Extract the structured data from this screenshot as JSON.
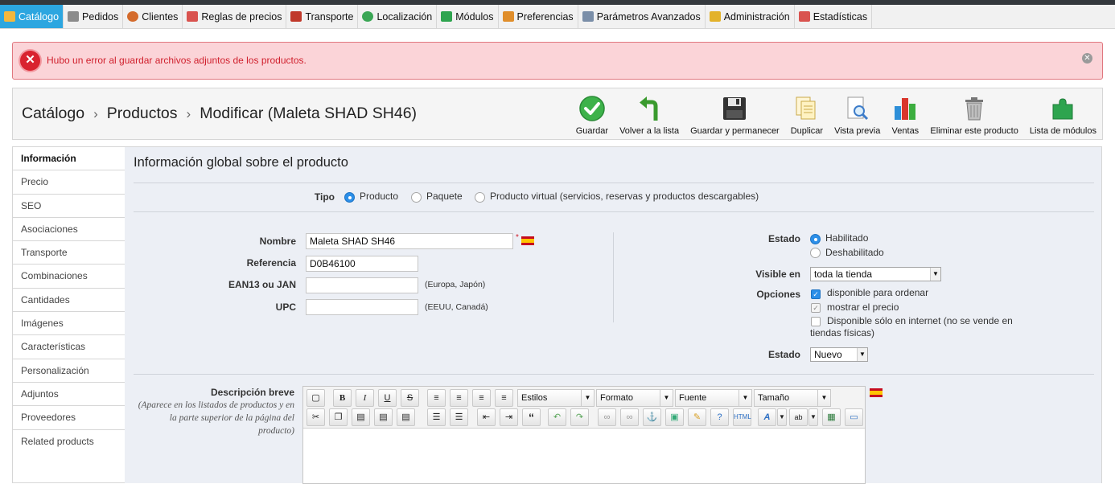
{
  "tabs": [
    {
      "label": "Catálogo",
      "icon": "folder-icon",
      "color": "#f3b73d",
      "active": true
    },
    {
      "label": "Pedidos",
      "icon": "cart-icon",
      "color": "#8b8b8b"
    },
    {
      "label": "Clientes",
      "icon": "user-icon",
      "color": "#d46b2c"
    },
    {
      "label": "Reglas de precios",
      "icon": "price-rules-icon",
      "color": "#d9534f"
    },
    {
      "label": "Transporte",
      "icon": "truck-icon",
      "color": "#c0392b"
    },
    {
      "label": "Localización",
      "icon": "globe-icon",
      "color": "#3aa655"
    },
    {
      "label": "Módulos",
      "icon": "puzzle-icon",
      "color": "#2ea44f"
    },
    {
      "label": "Preferencias",
      "icon": "preferences-icon",
      "color": "#e08e2b"
    },
    {
      "label": "Parámetros Avanzados",
      "icon": "wrench-icon",
      "color": "#7a8ea8"
    },
    {
      "label": "Administración",
      "icon": "key-icon",
      "color": "#e3b22b"
    },
    {
      "label": "Estadísticas",
      "icon": "bar-chart-icon",
      "color": "#d9534f"
    }
  ],
  "alert": {
    "message": "Hubo un error al guardar archivos adjuntos de los productos.",
    "icon": "error-icon",
    "close_icon": "close-icon"
  },
  "breadcrumb": {
    "items": [
      "Catálogo",
      "Productos",
      "Modificar (Maleta SHAD SH46)"
    ],
    "separator": "›"
  },
  "toolbar": [
    {
      "label": "Guardar",
      "icon": "checkmark-icon"
    },
    {
      "label": "Volver a la lista",
      "icon": "back-arrow-icon"
    },
    {
      "label": "Guardar y permanecer",
      "icon": "floppy-disk-icon"
    },
    {
      "label": "Duplicar",
      "icon": "duplicate-icon"
    },
    {
      "label": "Vista previa",
      "icon": "preview-icon"
    },
    {
      "label": "Ventas",
      "icon": "sales-chart-icon"
    },
    {
      "label": "Eliminar este producto",
      "icon": "trash-icon"
    },
    {
      "label": "Lista de módulos",
      "icon": "modules-puzzle-icon"
    }
  ],
  "sidenav": [
    {
      "label": "Información",
      "active": true
    },
    {
      "label": "Precio"
    },
    {
      "label": "SEO"
    },
    {
      "label": "Asociaciones"
    },
    {
      "label": "Transporte"
    },
    {
      "label": "Combinaciones"
    },
    {
      "label": "Cantidades"
    },
    {
      "label": "Imágenes"
    },
    {
      "label": "Características"
    },
    {
      "label": "Personalización"
    },
    {
      "label": "Adjuntos"
    },
    {
      "label": "Proveedores"
    },
    {
      "label": "Related products"
    }
  ],
  "form": {
    "heading": "Información global sobre el producto",
    "type": {
      "label": "Tipo",
      "options": [
        "Producto",
        "Paquete",
        "Producto virtual (servicios, reservas y productos descargables)"
      ],
      "selected": 0
    },
    "name": {
      "label": "Nombre",
      "value": "Maleta SHAD SH46",
      "required": "*"
    },
    "reference": {
      "label": "Referencia",
      "value": "D0B46100"
    },
    "ean": {
      "label": "EAN13 ou JAN",
      "value": "",
      "hint": "(Europa, Japón)"
    },
    "upc": {
      "label": "UPC",
      "value": "",
      "hint": "(EEUU, Canadá)"
    },
    "status": {
      "label": "Estado",
      "options": [
        "Habilitado",
        "Deshabilitado"
      ],
      "selected": 0
    },
    "visible": {
      "label": "Visible en",
      "value": "toda la tienda"
    },
    "options": {
      "label": "Opciones",
      "items": [
        {
          "label": "disponible para ordenar",
          "checked": true
        },
        {
          "label": "mostrar el precio",
          "checked": true,
          "disabled": true
        },
        {
          "label": "Disponible sólo en internet (no se vende en",
          "label2": "tiendas físicas)",
          "checked": false
        }
      ]
    },
    "condition": {
      "label": "Estado",
      "value": "Nuevo"
    },
    "short_desc": {
      "label": "Descripción breve",
      "note": "(Aparece en los listados de productos y en la parte superior de la página del producto)"
    },
    "editor": {
      "styles": "Estilos",
      "format": "Formato",
      "font": "Fuente",
      "size": "Tamaño"
    }
  },
  "colors": {
    "accent": "#2ca6e0",
    "error_bg": "#fbd4d8",
    "error_text": "#d01f2c"
  }
}
